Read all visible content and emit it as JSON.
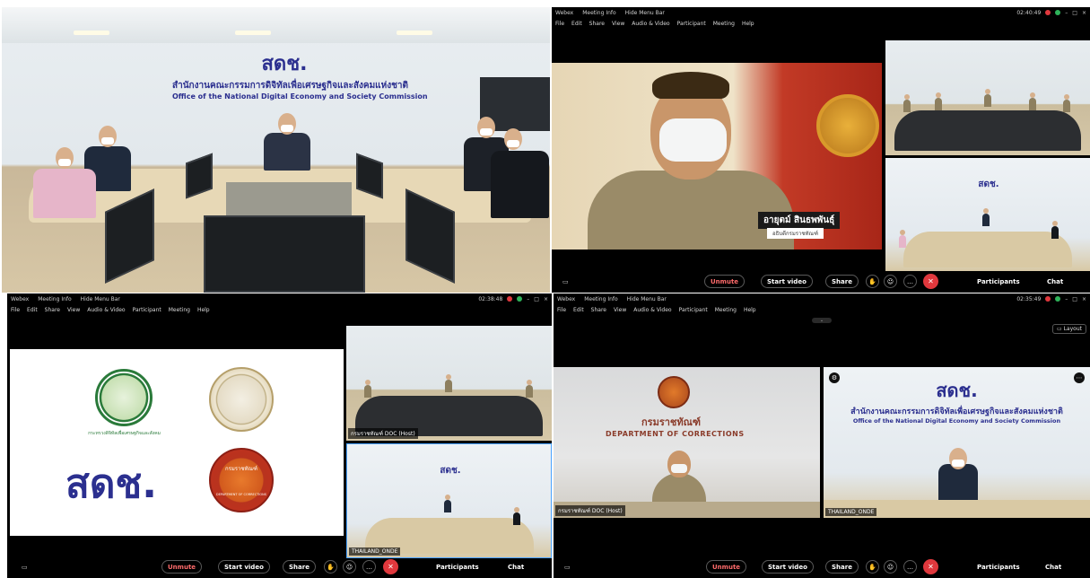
{
  "photo": {
    "logo_text": "สดช.",
    "thai_org": "สำนักงานคณะกรรมการดิจิทัลเพื่อเศรษฐกิจและสังคมแห่งชาติ",
    "eng_org": "Office of the National Digital Economy and Society Commission"
  },
  "webex_common": {
    "app_name": "Webex",
    "meeting_info": "Meeting Info",
    "hide_menu": "Hide Menu Bar",
    "menu": [
      "File",
      "Edit",
      "Share",
      "View",
      "Audio & Video",
      "Participant",
      "Meeting",
      "Help"
    ],
    "unmute": "Unmute",
    "start_video": "Start video",
    "share": "Share",
    "participants": "Participants",
    "chat": "Chat"
  },
  "top_right": {
    "time": "02:40:49",
    "speaker_name": "อายุตม์ สินธพพันธุ์",
    "speaker_title": "อธิบดีกรมราชทัณฑ์"
  },
  "bottom_left": {
    "time": "02:38:48",
    "tile_label_1": "กรมราชทัณฑ์ DOC (Host)",
    "tile_label_2": "THAILAND_ONDE",
    "slide_logo_text": "สดช.",
    "ministry_caption": "กระทรวงดิจิทัลเพื่อเศรษฐกิจและสังคม",
    "doc_seal_top": "กรมราชทัณฑ์",
    "doc_seal_bottom": "DEPARTMENT OF CORRECTIONS"
  },
  "bottom_right": {
    "time": "02:35:49",
    "layout_label": "Layout",
    "doc_th": "กรมราชทัณฑ์",
    "doc_en": "DEPARTMENT OF CORRECTIONS",
    "tile_label_1": "กรมราชทัณฑ์ DOC (Host)",
    "tile_label_2": "THAILAND_ONDE",
    "logo_text": "สดช.",
    "thai_org": "สำนักงานคณะกรรมการดิจิทัลเพื่อเศรษฐกิจและสังคมแห่งชาติ",
    "eng_org": "Office of the National Digital Economy and Society Commission"
  },
  "colors": {
    "end_call": "#e0383d",
    "brand_blue": "#2b2f8f",
    "brand_red": "#d2283c"
  }
}
